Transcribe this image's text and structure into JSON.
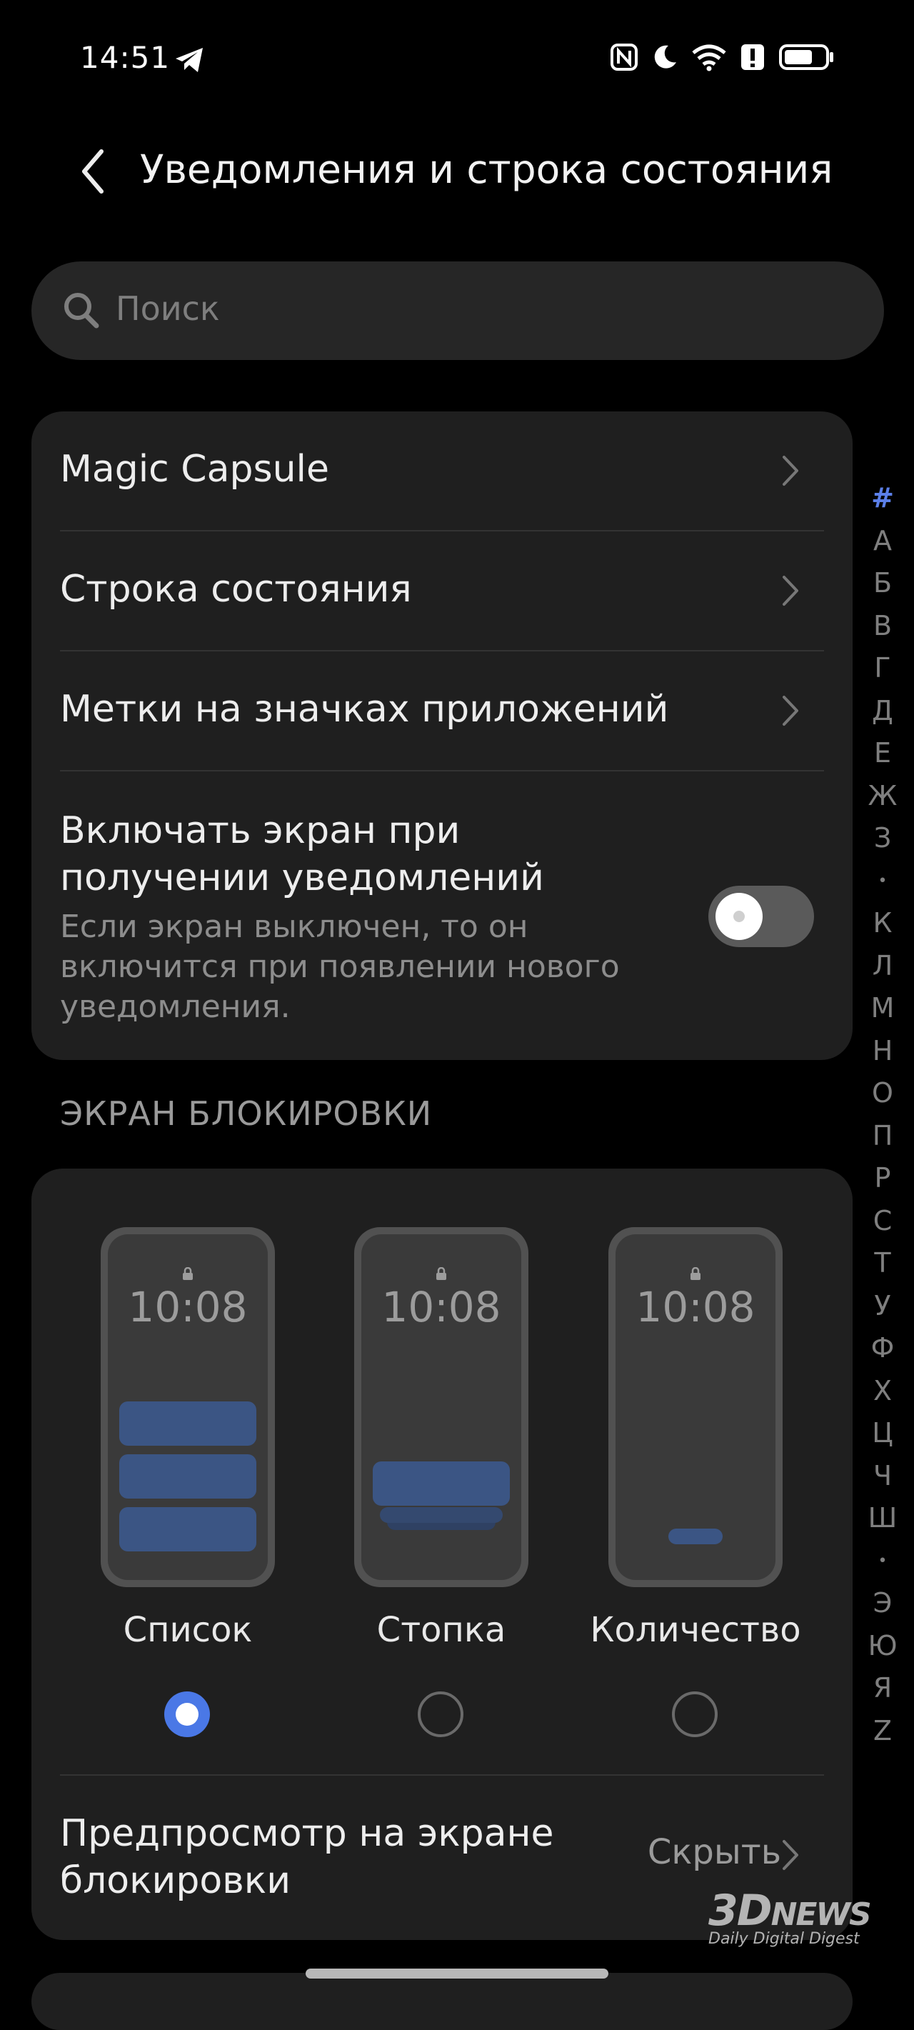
{
  "status_bar": {
    "time": "14:51",
    "icons": [
      "telegram-icon",
      "nfc-icon",
      "moon-icon",
      "wifi-icon",
      "alert-icon",
      "battery-icon"
    ]
  },
  "header": {
    "title": "Уведомления и строка состояния"
  },
  "search": {
    "placeholder": "Поиск"
  },
  "settings": {
    "magic_capsule": "Magic Capsule",
    "status_bar": "Строка состояния",
    "app_badges": "Метки на значках приложений",
    "wake_screen": {
      "title": "Включать экран при получении уведомлений",
      "description": "Если экран выключен, то он включится при появлении нового уведомления.",
      "enabled": false
    }
  },
  "lock_screen": {
    "section_title": "ЭКРАН БЛОКИРОВКИ",
    "preview_time": "10:08",
    "options": [
      {
        "label": "Список",
        "selected": true
      },
      {
        "label": "Стопка",
        "selected": false
      },
      {
        "label": "Количество",
        "selected": false
      }
    ],
    "preview_label": "Предпросмотр на экране блокировки",
    "preview_value": "Скрыть"
  },
  "alphabet_index": [
    "#",
    "А",
    "Б",
    "В",
    "Г",
    "Д",
    "Е",
    "Ж",
    "З",
    "•",
    "К",
    "Л",
    "М",
    "Н",
    "О",
    "П",
    "Р",
    "С",
    "Т",
    "У",
    "Ф",
    "Х",
    "Ц",
    "Ч",
    "Ш",
    "•",
    "Э",
    "Ю",
    "Я",
    "Z"
  ],
  "watermark": {
    "brand_prefix": "3D",
    "brand_suffix": "NEWS",
    "tagline": "Daily Digital Digest"
  },
  "colors": {
    "accent": "#4a78e6",
    "card": "#1f1f1f",
    "notification": "#3b5584"
  }
}
